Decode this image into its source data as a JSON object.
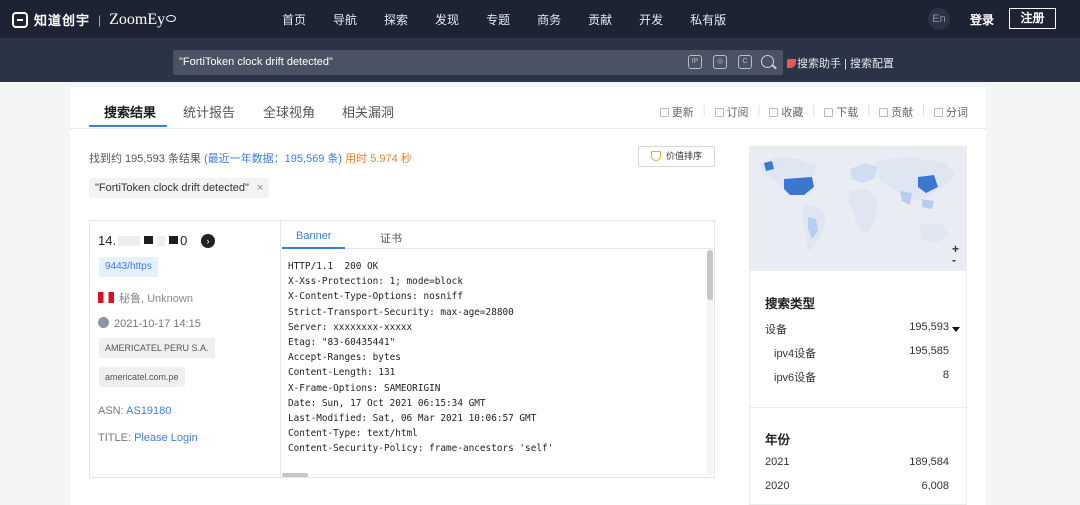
{
  "topnav": {
    "logo_cn": "知道创宇",
    "logo_en": "ZoomEy",
    "items": [
      "首页",
      "导航",
      "探索",
      "发现",
      "专题",
      "商务",
      "贡献",
      "开发",
      "私有版"
    ],
    "lang": "En",
    "login": "登录",
    "register": "注册"
  },
  "search": {
    "query": "\"FortiToken clock drift detected\"",
    "icons": [
      "ip-search-icon",
      "image-search-icon",
      "cert-search-icon",
      "search-icon"
    ],
    "help_text": "搜索助手 | 搜索配置"
  },
  "tabs": [
    "搜索结果",
    "统计报告",
    "全球视角",
    "相关漏洞"
  ],
  "actions": [
    "更新",
    "订阅",
    "收藏",
    "下载",
    "贡献",
    "分词"
  ],
  "summary": {
    "prefix": "找到约 195,593 条结果",
    "recent": "(最近一年数据：195,569 条)",
    "time": "用时 5.974 秒"
  },
  "sort_button": "价值排序",
  "filter_chip": "\"FortiToken clock drift detected\"",
  "result": {
    "ip_start": "14",
    "ip_end": "0",
    "port": "9443/https",
    "location": "秘鲁, Unknown",
    "timestamp": "2021-10-17 14:15",
    "org": "AMERICATEL PERU S.A.",
    "domain": "americatel.com.pe",
    "asn_label": "ASN:",
    "asn": "AS19180",
    "title_label": "TITLE:",
    "title": "Please Login",
    "subtabs": [
      "Banner",
      "证书"
    ],
    "banner_lines": [
      "HTTP/1.1  200 OK",
      "X-Xss-Protection: 1; mode=block",
      "X-Content-Type-Options: nosniff",
      "Strict-Transport-Security: max-age=28800",
      "Server: xxxxxxxx-xxxxx",
      "Etag: \"83-60435441\"",
      "Accept-Ranges: bytes",
      "Content-Length: 131",
      "X-Frame-Options: SAMEORIGIN",
      "Date: Sun, 17 Oct 2021 06:15:34 GMT",
      "Last-Modified: Sat, 06 Mar 2021 10:06:57 GMT",
      "Content-Type: text/html",
      "Content-Security-Policy: frame-ancestors 'self'"
    ]
  },
  "sidebar": {
    "map_zoom": [
      "+",
      "-"
    ],
    "type_title": "搜索类型",
    "type_rows": [
      {
        "label": "设备",
        "value": "195,593"
      },
      {
        "label": "ipv4设备",
        "value": "195,585"
      },
      {
        "label": "ipv6设备",
        "value": "8"
      }
    ],
    "year_title": "年份",
    "year_rows": [
      {
        "label": "2021",
        "value": "189,584"
      },
      {
        "label": "2020",
        "value": "6,008"
      }
    ]
  },
  "colors": {
    "accent": "#3c7fd6",
    "nav_bg": "#1d2333",
    "search_bg": "#2b3346",
    "map_highlight": "#3a78d0"
  }
}
